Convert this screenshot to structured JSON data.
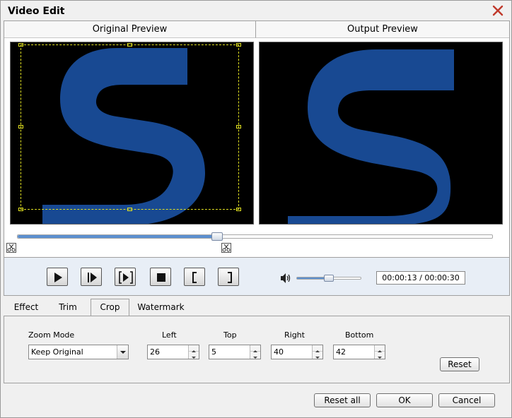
{
  "window": {
    "title": "Video Edit"
  },
  "preview": {
    "original_label": "Original Preview",
    "output_label": "Output Preview"
  },
  "timeline": {
    "position": 0.42
  },
  "playback": {
    "buttons": [
      "play-icon",
      "next-frame-icon",
      "step-forward-icon",
      "stop-icon",
      "mark-in-icon",
      "mark-out-icon"
    ],
    "volume_level": 0.5,
    "time": "00:00:13 / 00:00:30"
  },
  "tabs": [
    {
      "label": "Effect",
      "active": false
    },
    {
      "label": "Trim",
      "active": false
    },
    {
      "label": "Crop",
      "active": true
    },
    {
      "label": "Watermark",
      "active": false
    }
  ],
  "crop": {
    "zoom_mode_label": "Zoom Mode",
    "zoom_mode_value": "Keep Original",
    "left_label": "Left",
    "left_value": "26",
    "top_label": "Top",
    "top_value": "5",
    "right_label": "Right",
    "right_value": "40",
    "bottom_label": "Bottom",
    "bottom_value": "42",
    "reset_label": "Reset"
  },
  "footer": {
    "reset_all_label": "Reset all",
    "ok_label": "OK",
    "cancel_label": "Cancel"
  },
  "colors": {
    "video_bg": "#000000",
    "logo_blue": "#1a4f9e",
    "crop_line": "#e0e020",
    "accent": "#5b8fd0"
  }
}
